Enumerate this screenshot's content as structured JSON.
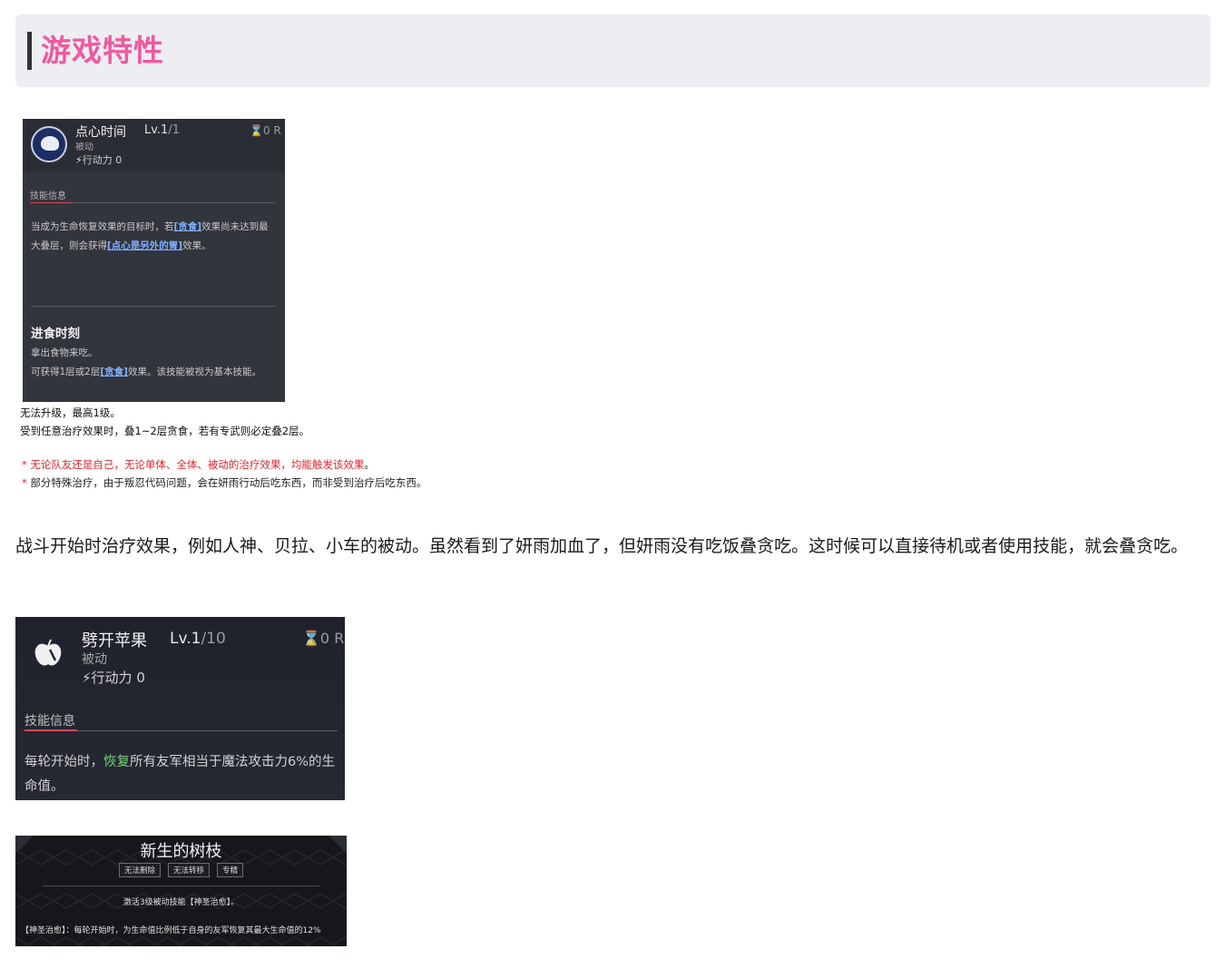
{
  "section": {
    "title": "游戏特性"
  },
  "card1": {
    "name": "点心时间",
    "level": "Lv.1",
    "level_max": "/1",
    "cooldown": "0 R",
    "type": "被动",
    "action_points": "行动力 0",
    "info_label": "技能信息",
    "desc_part1": "当成为生命恢复效果的目标时，若",
    "desc_link1": "[贪食]",
    "desc_part2": "效果尚未达到最大叠层，则会获得",
    "desc_link2": "[点心是另外的胃]",
    "desc_part3": "效果。",
    "sub_title": "进食时刻",
    "sub_desc_line1": "拿出食物来吃。",
    "sub_desc_part1": "可获得1层或2层",
    "sub_desc_link": "[贪食]",
    "sub_desc_part2": "效果。该技能被视为基本技能。"
  },
  "notes": {
    "line1": "无法升级，最高1级。",
    "line2": "受到任意治疗效果时，叠1~2层贪食，若有专武则必定叠2层。",
    "star1": "* ",
    "warn1_red": "无论队友还是自己，无论单体、全体、被动的治疗效果，均能触发该效果",
    "warn1_end": "。",
    "star2": "* ",
    "warn2": "部分特殊治疗，由于叛忍代码问题，会在妍雨行动后吃东西，而非受到治疗后吃东西。"
  },
  "paragraph": "战斗开始时治疗效果，例如人神、贝拉、小车的被动。虽然看到了妍雨加血了，但妍雨没有吃饭叠贪吃。这时候可以直接待机或者使用技能，就会叠贪吃。",
  "card2": {
    "name": "劈开苹果",
    "level": "Lv.1",
    "level_max": "/10",
    "cooldown": "0 R",
    "type": "被动",
    "action_points": "行动力 0",
    "info_label": "技能信息",
    "desc_part1": "每轮开始时，",
    "desc_green": "恢复",
    "desc_part2": "所有友军相当于魔法攻击力6%的生命值。"
  },
  "card3": {
    "title": "新生的树枝",
    "tags": [
      "无法删除",
      "无法转移",
      "专精"
    ],
    "line1": "激活3级被动技能【神圣治愈】。",
    "line2": "【神圣治愈】：每轮开始时，为生命值比例低于自身的友军恢复其最大生命值的12%"
  },
  "colors": {
    "title_pink": "#f0599f",
    "link_blue": "#7fb0ff",
    "warn_red": "#e8242d",
    "heal_green": "#7bd27a"
  },
  "icons": [
    "cake-icon",
    "hourglass-icon",
    "lightning-icon",
    "apple-icon"
  ]
}
